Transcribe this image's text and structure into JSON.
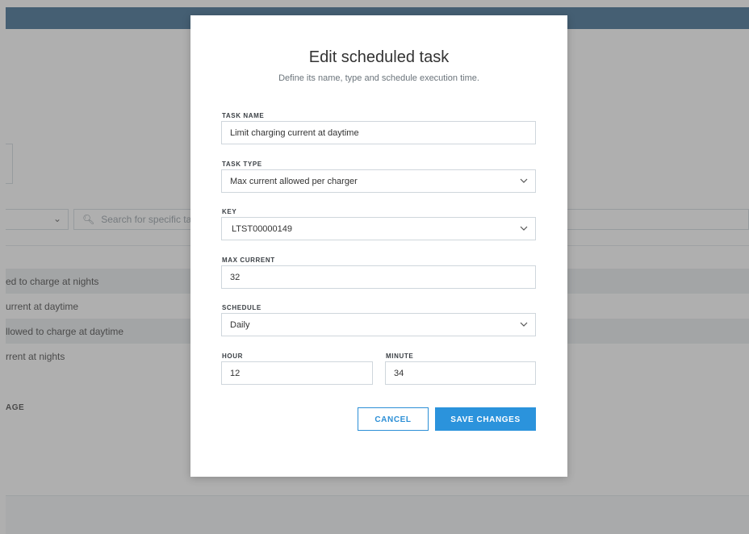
{
  "background": {
    "search_placeholder": "Search for specific task",
    "rows": [
      "ed to charge at nights",
      "urrent at daytime",
      "llowed to charge at daytime",
      "rrent at nights"
    ],
    "section_label": "AGE"
  },
  "modal": {
    "title": "Edit scheduled task",
    "subtitle": "Define its name, type and schedule execution time.",
    "task_name_label": "TASK NAME",
    "task_name_value": "Limit charging current at daytime",
    "task_type_label": "TASK TYPE",
    "task_type_value": "Max current allowed per charger",
    "key_label": "KEY",
    "key_value": "LTST00000149",
    "max_current_label": "MAX CURRENT",
    "max_current_value": "32",
    "schedule_label": "SCHEDULE",
    "schedule_value": "Daily",
    "hour_label": "HOUR",
    "hour_value": "12",
    "minute_label": "MINUTE",
    "minute_value": "34",
    "cancel_label": "CANCEL",
    "save_label": "SAVE CHANGES"
  },
  "colors": {
    "topbar": "#2a5f87",
    "primary": "#2b93dc",
    "overlay": "rgba(95,95,95,0.5)"
  },
  "icons": {
    "select_arrow": "chevron-down-icon",
    "search": "search-icon"
  }
}
